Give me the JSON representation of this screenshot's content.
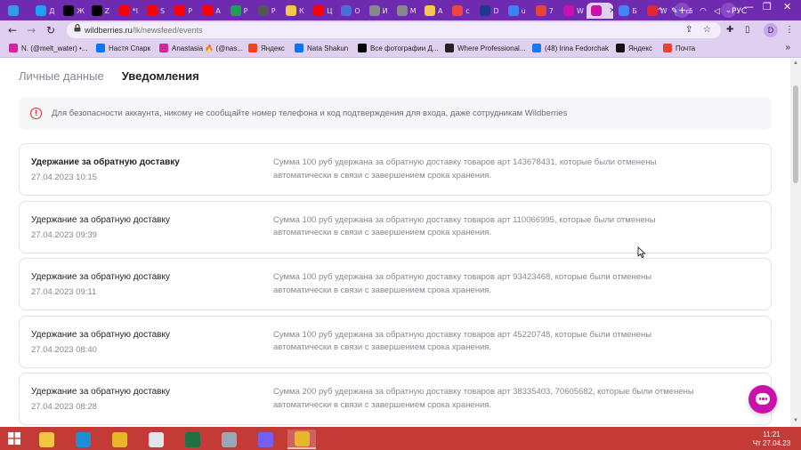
{
  "browser": {
    "tabs": [
      {
        "label": "",
        "color": "#2e9fe6"
      },
      {
        "label": "Д",
        "color": "#1da1f2"
      },
      {
        "label": "Ж",
        "color": "#000000"
      },
      {
        "label": "Z",
        "color": "#000000"
      },
      {
        "label": "*l",
        "color": "#ff0000"
      },
      {
        "label": "S",
        "color": "#ff0000"
      },
      {
        "label": "P",
        "color": "#ff0000"
      },
      {
        "label": "A",
        "color": "#ff0000"
      },
      {
        "label": "P",
        "color": "#1f9d55"
      },
      {
        "label": "P",
        "color": "#555555"
      },
      {
        "label": "К",
        "color": "#f2c94c"
      },
      {
        "label": "Ц",
        "color": "#ff0000"
      },
      {
        "label": "O",
        "color": "#4a6fd8"
      },
      {
        "label": "И",
        "color": "#888888"
      },
      {
        "label": "М",
        "color": "#888888"
      },
      {
        "label": "A",
        "color": "#f2c94c"
      },
      {
        "label": "c",
        "color": "#ef4444"
      },
      {
        "label": "D",
        "color": "#1e3a8a"
      },
      {
        "label": "u",
        "color": "#3b82f6"
      },
      {
        "label": "7",
        "color": "#ea4335"
      },
      {
        "label": "W",
        "color": "#cb11ab"
      },
      {
        "label": "",
        "color": "#cb11ab",
        "active": true
      },
      {
        "label": "Б",
        "color": "#4285f4"
      },
      {
        "label": "W",
        "color": "#e32636"
      },
      {
        "label": "T",
        "color": "#25d366"
      }
    ],
    "new_tab_symbol": "+",
    "tab_search_symbol": "⌄",
    "window_controls": [
      "—",
      "❐",
      "✕"
    ],
    "url_host": "wildberries.ru",
    "url_path": "/lk/newsfeed/events",
    "profile_letter": "D",
    "bookmarks": [
      {
        "label": "N. (@melt_water) •...",
        "color": "#d6249f"
      },
      {
        "label": "Настя Спарк",
        "color": "#0077ff"
      },
      {
        "label": "Anastasia 🔥 (@nas...",
        "color": "#d6249f"
      },
      {
        "label": "Яндекс",
        "color": "#fc3f1d"
      },
      {
        "label": "Nata Shakun",
        "color": "#0077ff"
      },
      {
        "label": "Все фотографии Д...",
        "color": "#000000"
      },
      {
        "label": "Where Professional...",
        "color": "#222222"
      },
      {
        "label": "(48) Irina Fedorchak",
        "color": "#1877f2"
      },
      {
        "label": "Яндекс",
        "color": "#111111"
      },
      {
        "label": "Почта",
        "color": "#ea4335"
      }
    ],
    "bookmarks_more": "»"
  },
  "page": {
    "tabs": [
      {
        "label": "Личные данные",
        "active": false
      },
      {
        "label": "Уведомления",
        "active": true
      }
    ],
    "alert": {
      "icon": "!",
      "text": "Для безопасности аккаунта, никому не сообщайте номер телефона и код подтверждения для входа, даже сотрудникам Wildberries"
    },
    "events": [
      {
        "title": "Удержание за обратную доставку",
        "date": "27.04.2023 10:15",
        "unread": true,
        "text": "Сумма 100 руб удержана за обратную доставку товаров арт 143678431, которые были отменены автоматически в связи с завершением срока хранения."
      },
      {
        "title": "Удержание за обратную доставку",
        "date": "27.04.2023 09:39",
        "unread": false,
        "text": "Сумма 100 руб удержана за обратную доставку товаров арт 110066995, которые были отменены автоматически в связи с завершением срока хранения."
      },
      {
        "title": "Удержание за обратную доставку",
        "date": "27.04.2023 09:11",
        "unread": false,
        "text": "Сумма 100 руб удержана за обратную доставку товаров арт 93423468, которые были отменены автоматически в связи с завершением срока хранения."
      },
      {
        "title": "Удержание за обратную доставку",
        "date": "27.04.2023 08:40",
        "unread": false,
        "text": "Сумма 100 руб удержана за обратную доставку товаров арт 45220748, которые были отменены автоматически в связи с завершением срока хранения."
      },
      {
        "title": "Удержание за обратную доставку",
        "date": "27.04.2023 08:28",
        "unread": false,
        "text": "Сумма 200 руб удержана за обратную доставку товаров арт 38335403, 70605682, которые были отменены автоматически в связи с завершением срока хранения."
      }
    ],
    "accent_color": "#cb11ab"
  },
  "taskbar": {
    "apps": [
      {
        "icon": "file-explorer-icon",
        "color": "#f4c542"
      },
      {
        "icon": "edge-icon",
        "color": "#1d8fd6"
      },
      {
        "icon": "chrome-icon",
        "color": "#e8b62a"
      },
      {
        "icon": "calculator-icon",
        "color": "#dfe6ee"
      },
      {
        "icon": "excel-icon",
        "color": "#1e7145"
      },
      {
        "icon": "messenger-icon",
        "color": "#9aa7b6"
      },
      {
        "icon": "viber-icon",
        "color": "#7360f2"
      },
      {
        "icon": "chrome-profile-icon",
        "color": "#e8b62a",
        "active": true
      }
    ],
    "tray": {
      "expand": "^",
      "lang": "РУС"
    },
    "time": "11:21",
    "date": "Чт 27.04.23"
  }
}
